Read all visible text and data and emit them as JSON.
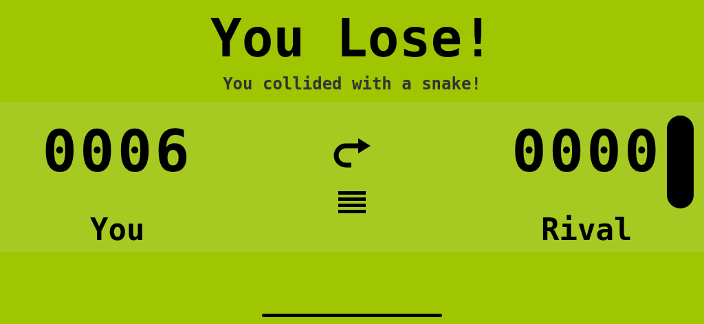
{
  "title": "You Lose!",
  "subtitle": "You collided with a snake!",
  "players": [
    {
      "score": "0006",
      "name": "You"
    },
    {
      "score": "0000",
      "name": "Rival"
    }
  ]
}
